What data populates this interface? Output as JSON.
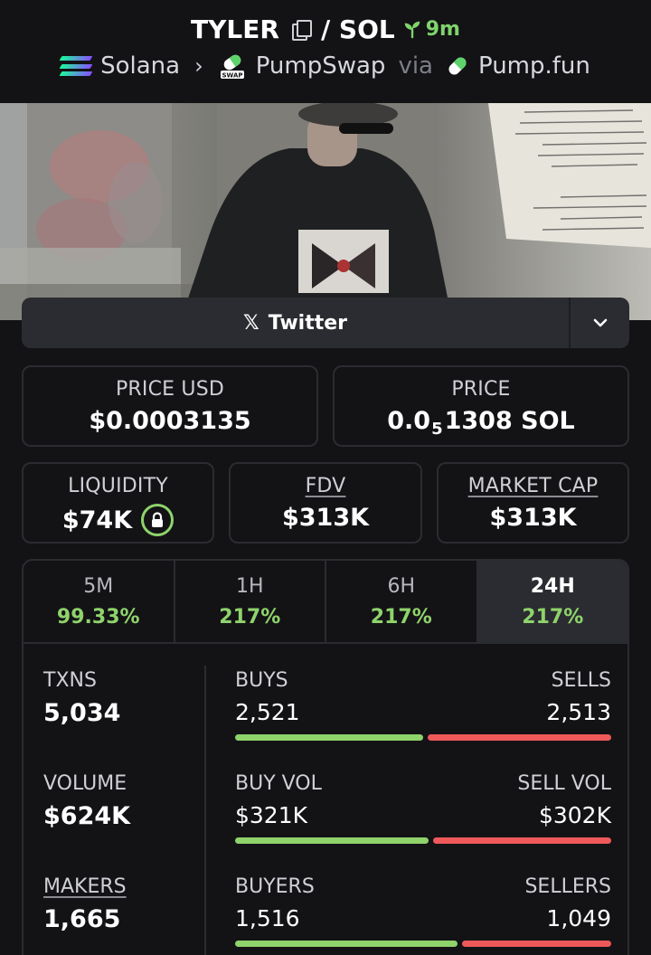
{
  "header": {
    "symbol": "TYLER",
    "quote": "/ SOL",
    "age": "9m",
    "chain": "Solana",
    "dex": "PumpSwap",
    "dex_badge": "SWAP",
    "via": "via",
    "launchpad": "Pump.fun"
  },
  "social": {
    "twitter_label": "Twitter",
    "x_glyph": "𝕏"
  },
  "price_usd": {
    "label": "PRICE USD",
    "value": "$0.0003135"
  },
  "price": {
    "label": "PRICE",
    "lead": "0.0",
    "zeros": "5",
    "rest": "1308 SOL"
  },
  "liquidity": {
    "label": "LIQUIDITY",
    "value": "$74K"
  },
  "fdv": {
    "label": "FDV",
    "value": "$313K"
  },
  "market_cap": {
    "label": "MARKET CAP",
    "value": "$313K"
  },
  "tabs": [
    {
      "label": "5M",
      "change": "99.33%"
    },
    {
      "label": "1H",
      "change": "217%"
    },
    {
      "label": "6H",
      "change": "217%"
    },
    {
      "label": "24H",
      "change": "217%"
    }
  ],
  "active_tab": "24H",
  "metrics": {
    "txns": {
      "label": "TXNS",
      "value": "5,034"
    },
    "volume": {
      "label": "VOLUME",
      "value": "$624K"
    },
    "makers": {
      "label": "MAKERS",
      "value": "1,665"
    }
  },
  "splits": {
    "buys": {
      "left_label": "BUYS",
      "right_label": "SELLS",
      "left_value": "2,521",
      "right_value": "2,513",
      "buy_ratio": 0.501
    },
    "vol": {
      "left_label": "BUY VOL",
      "right_label": "SELL VOL",
      "left_value": "$321K",
      "right_value": "$302K",
      "buy_ratio": 0.515
    },
    "makers": {
      "left_label": "BUYERS",
      "right_label": "SELLERS",
      "left_value": "1,516",
      "right_value": "1,049",
      "buy_ratio": 0.591
    }
  },
  "colors": {
    "green": "#8fd36b",
    "red": "#ef5959",
    "panel": "#2b2c31",
    "bg": "#131316"
  },
  "icons": [
    "copy-icon",
    "sprout-icon",
    "solana-icon",
    "chevron-right-icon",
    "pumpswap-icon",
    "pill-icon",
    "x-logo-icon",
    "chevron-down-icon",
    "lock-icon"
  ]
}
